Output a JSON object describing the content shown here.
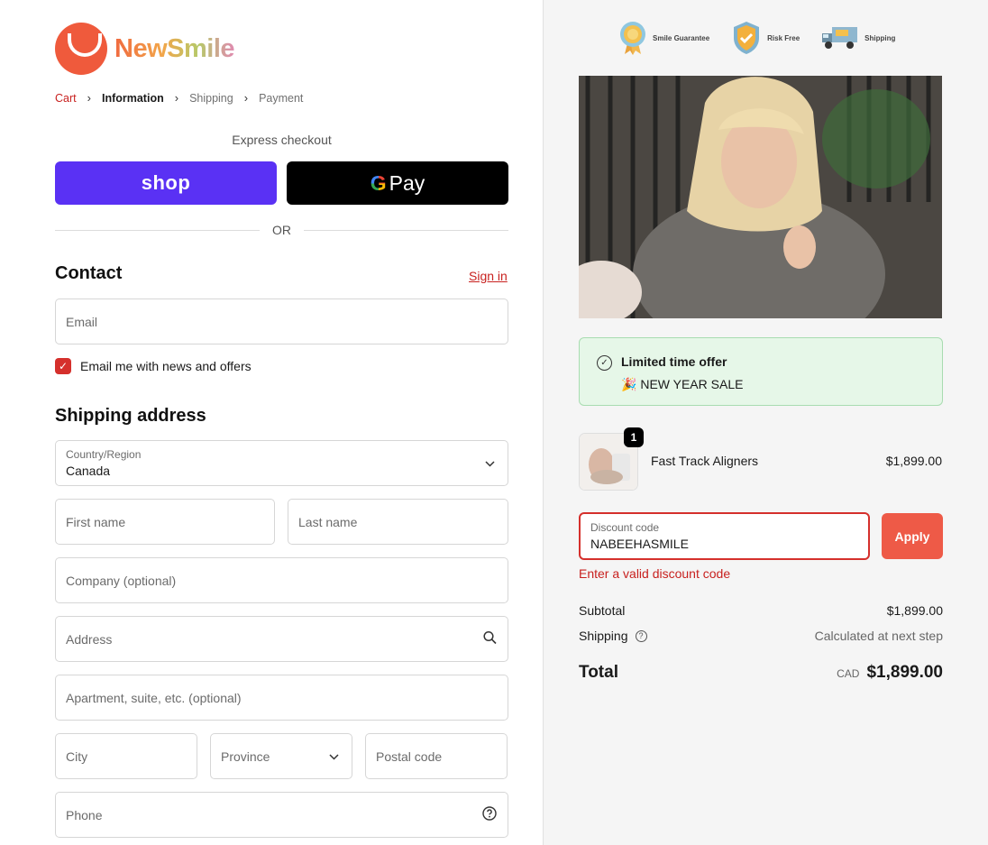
{
  "brand": {
    "name": "NewSmile"
  },
  "breadcrumb": [
    {
      "label": "Cart"
    },
    {
      "label": "Information"
    },
    {
      "label": "Shipping"
    },
    {
      "label": "Payment"
    }
  ],
  "express": {
    "label": "Express checkout",
    "shop_label": "shop",
    "gpay_label": "Pay",
    "or_label": "OR"
  },
  "contact": {
    "heading": "Contact",
    "signin_label": "Sign in",
    "email_placeholder": "Email",
    "newsletter_label": "Email me with news and offers",
    "newsletter_checked": true
  },
  "shipping": {
    "heading": "Shipping address",
    "country_label": "Country/Region",
    "country_value": "Canada",
    "first_name": "First name",
    "last_name": "Last name",
    "company": "Company (optional)",
    "address": "Address",
    "apartment": "Apartment, suite, etc. (optional)",
    "city": "City",
    "province": "Province",
    "postal": "Postal code",
    "phone": "Phone"
  },
  "badges": [
    {
      "label": "Smile Guarantee",
      "icon": "ribbon-medal-icon"
    },
    {
      "label": "Risk Free",
      "icon": "shield-check-icon"
    },
    {
      "label": "Shipping",
      "icon": "delivery-truck-icon"
    }
  ],
  "offer": {
    "title": "Limited time offer",
    "emoji": "🎉",
    "subtitle": "NEW YEAR SALE"
  },
  "product": {
    "name": "Fast Track Aligners",
    "price": "$1,899.00",
    "quantity": "1"
  },
  "discount": {
    "label": "Discount code",
    "value": "NABEEHASMILE",
    "apply_label": "Apply",
    "error": "Enter a valid discount code"
  },
  "summary": {
    "subtotal_label": "Subtotal",
    "subtotal_value": "$1,899.00",
    "shipping_label": "Shipping",
    "shipping_value": "Calculated at next step",
    "total_label": "Total",
    "currency": "CAD",
    "total_value": "$1,899.00"
  },
  "colors": {
    "accent_red": "#c8211f",
    "shop_purple": "#5a31f4",
    "apply_coral": "#ee5a47",
    "offer_green": "#e6f7e8"
  }
}
